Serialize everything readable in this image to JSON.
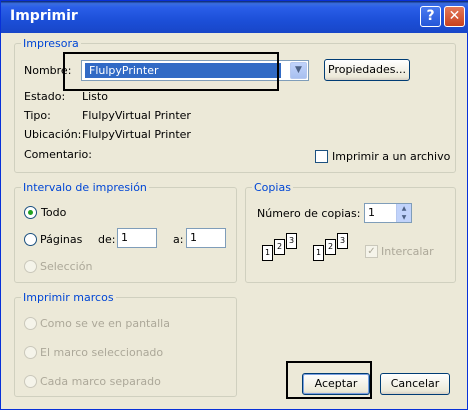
{
  "window": {
    "title": "Imprimir",
    "help": "?",
    "close": "✕"
  },
  "printer": {
    "legend": "Impresora",
    "name_label": "Nombre:",
    "name_value": "FlulpyPrinter",
    "properties_button": "Propiedades...",
    "status_label": "Estado:",
    "status_value": "Listo",
    "type_label": "Tipo:",
    "type_value": "FlulpyVirtual Printer",
    "location_label": "Ubicación:",
    "location_value": "FlulpyVirtual Printer",
    "comment_label": "Comentario:",
    "print_to_file": "Imprimir a un archivo",
    "print_to_file_checked": false
  },
  "range": {
    "legend": "Intervalo de impresión",
    "all": "Todo",
    "pages": "Páginas",
    "from_label": "de:",
    "from_value": "1",
    "to_label": "a:",
    "to_value": "1",
    "selection": "Selección",
    "selected": "all"
  },
  "copies": {
    "legend": "Copias",
    "count_label": "Número de copias:",
    "count_value": "1",
    "collate": "Intercalar",
    "collate_checked": true,
    "stack_pages": [
      "1",
      "2",
      "3"
    ]
  },
  "frames": {
    "legend": "Imprimir marcos",
    "as_on_screen": "Como se ve en pantalla",
    "selected_frame": "El marco seleccionado",
    "each_frame": "Cada marco separado"
  },
  "buttons": {
    "ok": "Aceptar",
    "cancel": "Cancelar"
  },
  "colors": {
    "titlebar": "#1c4fd8",
    "legend": "#0046d5",
    "disabled": "#aca899"
  }
}
